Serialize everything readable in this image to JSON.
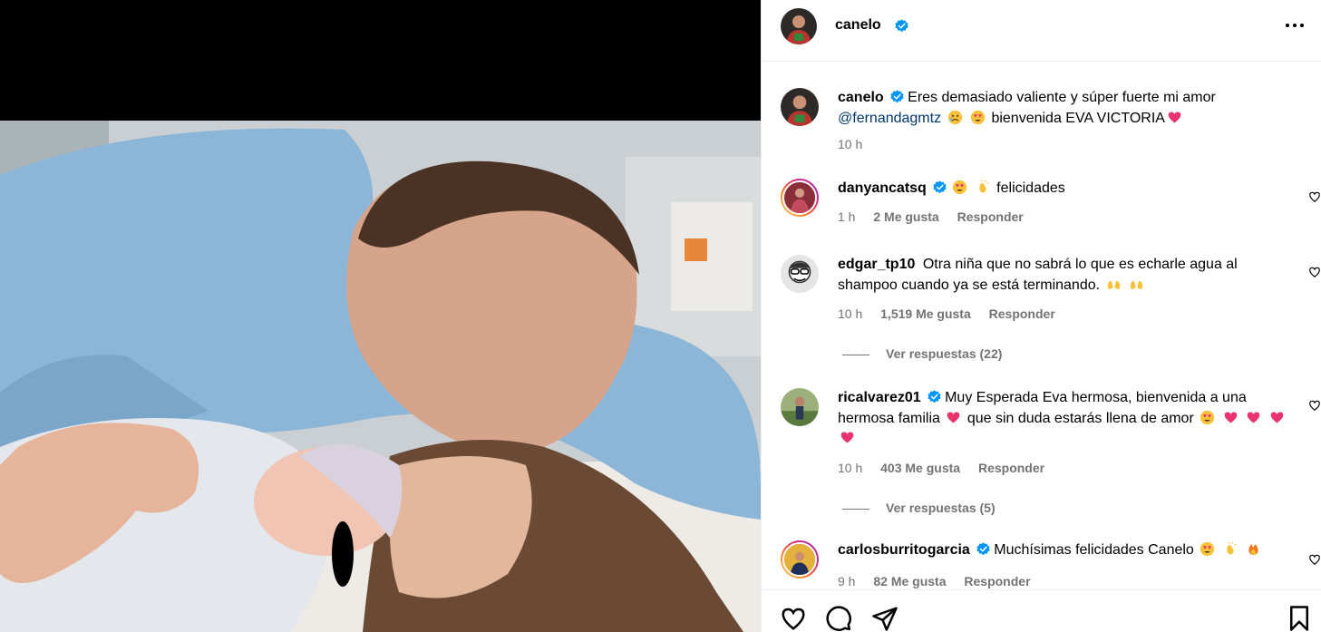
{
  "post": {
    "author": "canelo",
    "more_icon": "more-horizontal-icon"
  },
  "caption": {
    "username": "canelo",
    "text_1": "Eres demasiado valiente y súper fuerte mi amor",
    "mention": "@fernandagmtz",
    "text_2": "bienvenida EVA VICTORIA",
    "time": "10 h"
  },
  "comments": [
    {
      "username": "danyancatsq",
      "verified": true,
      "text": "felicidades",
      "time": "1 h",
      "likes": "2 Me gusta",
      "reply": "Responder"
    },
    {
      "username": "edgar_tp10",
      "verified": false,
      "text": "Otra niña que no sabrá lo que es echarle agua al shampoo cuando ya se está terminando.",
      "time": "10 h",
      "likes": "1,519 Me gusta",
      "reply": "Responder",
      "view_replies": "Ver respuestas (22)"
    },
    {
      "username": "ricalvarez01",
      "verified": true,
      "text_1": "Muy Esperada Eva hermosa, bienvenida a una hermosa familia",
      "text_2": "que sin duda estarás llena de amor",
      "time": "10 h",
      "likes": "403 Me gusta",
      "reply": "Responder",
      "view_replies": "Ver respuestas (5)"
    },
    {
      "username": "carlosburritogarcia",
      "verified": true,
      "text": "Muchísimas felicidades Canelo",
      "time": "9 h",
      "likes": "82 Me gusta",
      "reply": "Responder"
    }
  ],
  "colors": {
    "verified": "#0095f6",
    "mention": "#00376b",
    "meta": "#737373",
    "heart_emoji": "#e8336f"
  }
}
